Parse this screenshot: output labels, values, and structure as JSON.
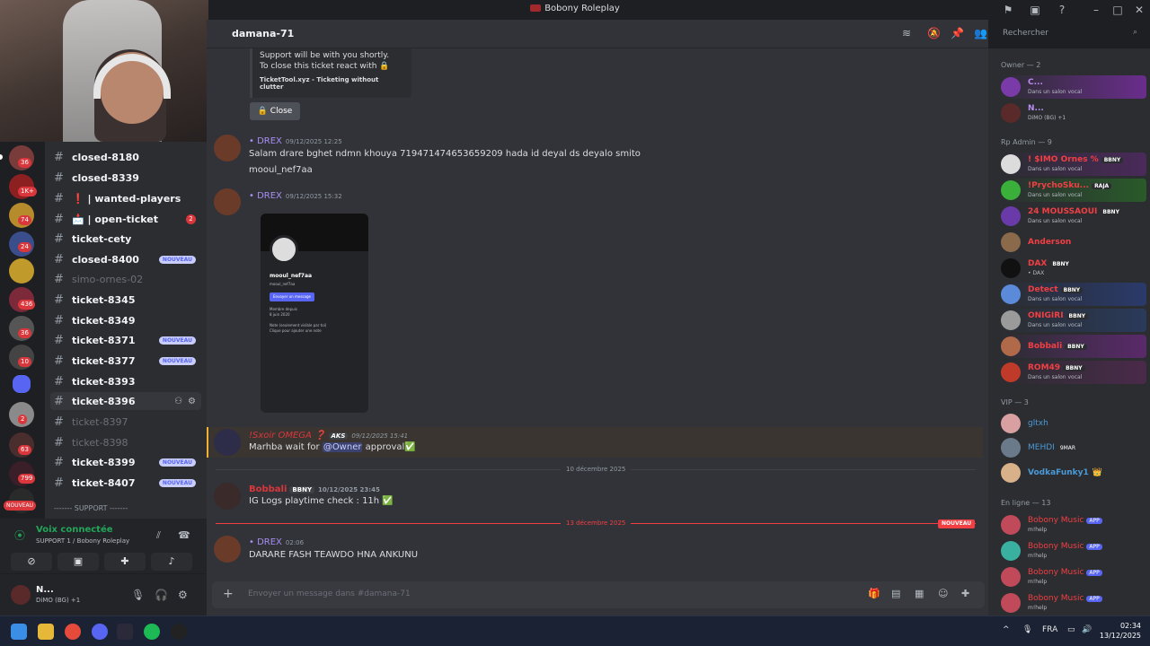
{
  "window": {
    "title": "Bobony Roleplay"
  },
  "colors": {
    "accent": "#5865f2",
    "online": "#23a559",
    "danger": "#da373c",
    "divider_red": "#f23f43"
  },
  "servers": [
    {
      "badge": "36"
    },
    {
      "badge": "1K+"
    },
    {
      "badge": "74"
    },
    {
      "badge": "24"
    },
    {
      "badge": ""
    },
    {
      "badge": "436"
    },
    {
      "badge": "36"
    },
    {
      "badge": "10"
    },
    {
      "badge": ""
    },
    {
      "badge": "2"
    },
    {
      "badge": "63"
    },
    {
      "badge": "799"
    },
    {
      "badge": "NOUVEAU"
    }
  ],
  "channels": [
    {
      "name": "closed-8180",
      "badge": "",
      "muted": false
    },
    {
      "name": "closed-8339",
      "badge": "",
      "muted": false
    },
    {
      "name": "❗ | wanted-players",
      "badge": "",
      "muted": false
    },
    {
      "name": "📩 | open-ticket",
      "badge": "2",
      "muted": false
    },
    {
      "name": "ticket-cety",
      "badge": "",
      "muted": false
    },
    {
      "name": "closed-8400",
      "badge": "NOUVEAU",
      "muted": false
    },
    {
      "name": "simo-ornes-02",
      "badge": "",
      "muted": true
    },
    {
      "name": "ticket-8345",
      "badge": "",
      "muted": false
    },
    {
      "name": "ticket-8349",
      "badge": "",
      "muted": false
    },
    {
      "name": "ticket-8371",
      "badge": "NOUVEAU",
      "muted": false
    },
    {
      "name": "ticket-8377",
      "badge": "NOUVEAU",
      "muted": false
    },
    {
      "name": "ticket-8393",
      "badge": "",
      "muted": false
    },
    {
      "name": "ticket-8396",
      "badge": "",
      "muted": false
    },
    {
      "name": "ticket-8397",
      "badge": "",
      "muted": true
    },
    {
      "name": "ticket-8398",
      "badge": "",
      "muted": true
    },
    {
      "name": "ticket-8399",
      "badge": "NOUVEAU",
      "muted": false
    },
    {
      "name": "ticket-8407",
      "badge": "NOUVEAU",
      "muted": false
    }
  ],
  "category_support": "------- SUPPORT -------",
  "voice": {
    "status": "Voix connectée",
    "channel": "SUPPORT 1 / Bobony Roleplay"
  },
  "user": {
    "name": "N...",
    "status": "DiMO (BG) +1"
  },
  "header": {
    "channel": "damana-71",
    "search_placeholder": "Rechercher"
  },
  "embed": {
    "line1": "Support will be with you shortly.",
    "line2": "To close this ticket react with 🔒",
    "footer": "TicketTool.xyz - Ticketing without clutter",
    "close_label": "Close"
  },
  "messages": [
    {
      "author": "• DREX",
      "time": "09/12/2025 12:25",
      "text": "Salam drare bghet ndmn khouya 719471474653659209 hada id deyal ds deyalo smito",
      "text2": "mooul_nef7aa"
    },
    {
      "author": "• DREX",
      "time": "09/12/2025 15:32"
    },
    {
      "author": "!Sxoir OMEGA ❓",
      "role": "AKS",
      "time": "09/12/2025 15:41",
      "text": "Marhba wait for",
      "mention": "@Owner",
      "text_end": "approval✅"
    },
    {
      "author": "Bobbali",
      "role": "BBNY",
      "time": "10/12/2025 23:45",
      "text": "IG Logs playtime check : 11h ✅"
    },
    {
      "author": "• DREX",
      "time": "02:06",
      "text": "DARARE FASH TEAWDO HNA ANKUNU"
    }
  ],
  "attachment": {
    "name": "mooul_nef7aa",
    "handle": "mooul_nef7aa",
    "button": "Envoyer un message",
    "member_since_label": "Membre depuis",
    "member_since": "8 juin 2020",
    "note": "Note (seulement visible par toi)",
    "note_ph": "Clique pour ajouter une note"
  },
  "dividers": {
    "d1": "10 décembre 2025",
    "d2": "13 décembre 2025",
    "new_label": "NOUVEAU"
  },
  "composer": {
    "placeholder": "Envoyer un message dans #damana-71"
  },
  "members": {
    "groups": {
      "owner": "Owner — 2",
      "rpadmin": "Rp Admin — 9",
      "vip": "VIP — 3",
      "online": "En ligne — 13"
    },
    "owner": [
      {
        "name": "C...",
        "status": "Dans un salon vocal"
      },
      {
        "name": "N...",
        "status": "DiMO (BG) +1"
      }
    ],
    "rpadmin": [
      {
        "name": "! $IMO Ornes %",
        "badge": "BBNY",
        "status": "Dans un salon vocal"
      },
      {
        "name": "!PrychoSku...",
        "badge": "RAJA",
        "status": "Dans un salon vocal"
      },
      {
        "name": "24 MOUSSAOUI",
        "badge": "BBNY",
        "status": "Dans un salon vocal"
      },
      {
        "name": "Anderson",
        "badge": "",
        "status": ""
      },
      {
        "name": "DAX",
        "badge": "BBNY",
        "status": "• DAX"
      },
      {
        "name": "Detect",
        "badge": "BBNY",
        "status": "Dans un salon vocal"
      },
      {
        "name": "ONIGIRI",
        "badge": "BBNY",
        "status": "Dans un salon vocal"
      },
      {
        "name": "Bobbali",
        "badge": "BBNY",
        "status": ""
      },
      {
        "name": "ROM49",
        "badge": "BBNY",
        "status": "Dans un salon vocal"
      }
    ],
    "vip": [
      {
        "name": "gltxh",
        "badge": ""
      },
      {
        "name": "MEHDI",
        "badge": "9MAR"
      },
      {
        "name": "VodkaFunky1",
        "badge": "👑"
      }
    ],
    "online": [
      {
        "name": "Bobony Music",
        "badge": "APP",
        "status": "m!help"
      },
      {
        "name": "Bobony Music",
        "badge": "APP",
        "status": "m!help"
      },
      {
        "name": "Bobony Music",
        "badge": "APP",
        "status": "m!help"
      },
      {
        "name": "Bobony Music",
        "badge": "APP",
        "status": "m!help"
      }
    ]
  },
  "taskbar": {
    "lang": "FRA",
    "time": "02:34",
    "date": "13/12/2025"
  }
}
